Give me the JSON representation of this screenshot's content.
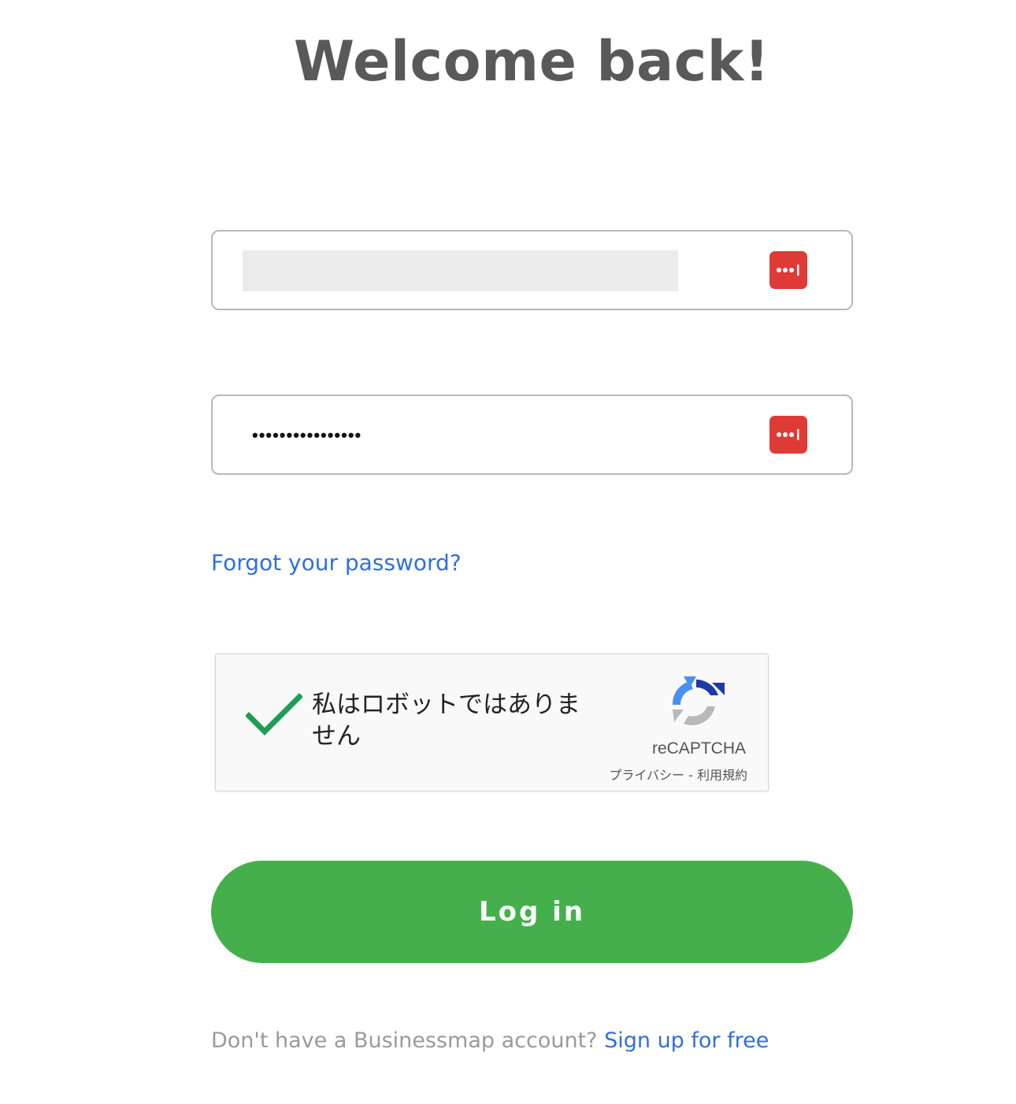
{
  "title": "Welcome back!",
  "email_field": {
    "value": "",
    "icon": "lastpass-icon"
  },
  "password_field": {
    "value": "••••••••••••••••",
    "icon": "lastpass-icon"
  },
  "forgot_link": "Forgot your password?",
  "recaptcha": {
    "checked": true,
    "label": "私はロボットではありません",
    "brand": "reCAPTCHA",
    "privacy": "プライバシー",
    "separator": " - ",
    "terms": "利用規約"
  },
  "login_button": "Log in",
  "signup": {
    "prompt": "Don't have a Businessmap account?",
    "link": "Sign up for free"
  },
  "colors": {
    "primary_green": "#45b04b",
    "link_blue": "#2f6fde",
    "lastpass_red": "#e03a36",
    "title_gray": "#595959"
  }
}
